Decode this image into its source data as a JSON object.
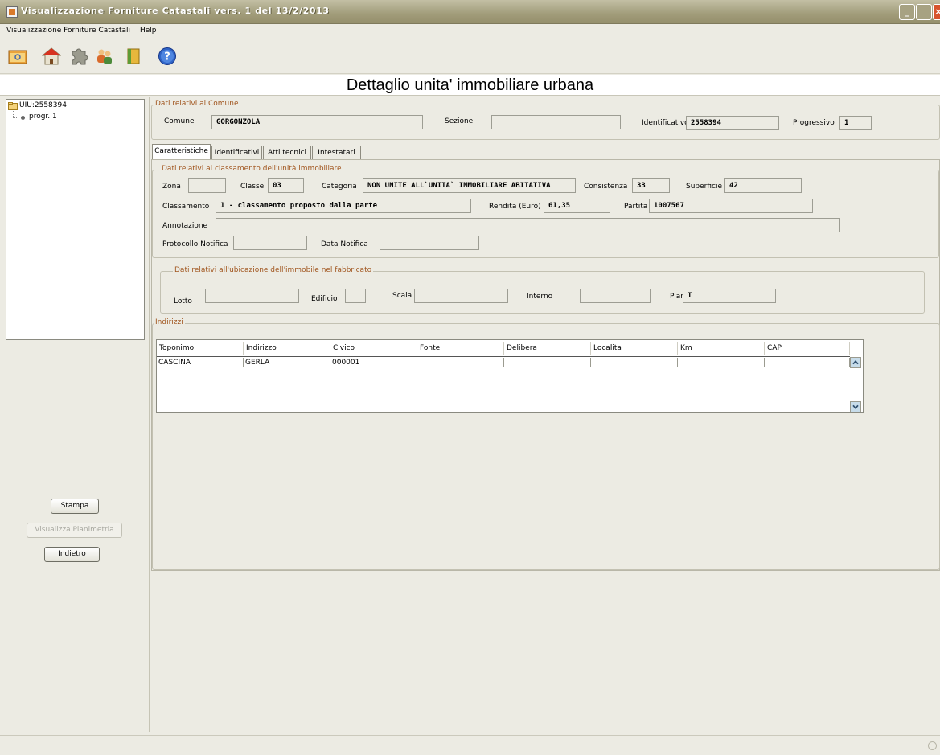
{
  "window": {
    "title": "Visualizzazione Forniture Catastali vers. 1 del 13/2/2013",
    "minimize_label": "_",
    "maximize_label": "▫",
    "close_label": "×"
  },
  "menu": {
    "items": [
      "Visualizzazione Forniture Catastali",
      "Help"
    ]
  },
  "toolbar": {
    "icons": [
      "open-folder-icon",
      "house-icon",
      "puzzle-icon",
      "users-icon",
      "book-icon",
      "help-icon"
    ]
  },
  "page_title": "Dettaglio unita' immobiliare urbana",
  "tree": {
    "root": "UIU:2558394",
    "child": "progr. 1"
  },
  "buttons": {
    "stampa": "Stampa",
    "visualizza": "Visualizza Planimetria",
    "indietro": "Indietro"
  },
  "comune_group": {
    "legend": "Dati relativi al Comune",
    "comune_label": "Comune",
    "comune_value": "GORGONZOLA",
    "sezione_label": "Sezione",
    "sezione_value": "",
    "identificativo_label": "Identificativo",
    "identificativo_value": "2558394",
    "progressivo_label": "Progressivo",
    "progressivo_value": "1"
  },
  "tabs": [
    "Caratteristiche",
    "Identificativi",
    "Atti tecnici",
    "Intestatari"
  ],
  "classamento": {
    "legend": "Dati relativi al classamento dell'unità immobiliare",
    "zona_label": "Zona",
    "zona_value": "",
    "classe_label": "Classe",
    "classe_value": "03",
    "categoria_label": "Categoria",
    "categoria_value": "NON UNITE ALL`UNITA` IMMOBILIARE ABITATIVA",
    "consistenza_label": "Consistenza",
    "consistenza_value": "33",
    "superficie_label": "Superficie",
    "superficie_value": "42",
    "classamento_label": "Classamento",
    "classamento_value": "1 - classamento proposto dalla parte",
    "rendita_label": "Rendita (Euro)",
    "rendita_value": "61,35",
    "partita_label": "Partita",
    "partita_value": "1007567",
    "annotazione_label": "Annotazione",
    "annotazione_value": "",
    "protocollo_label": "Protocollo Notifica",
    "protocollo_value": "",
    "data_label": "Data Notifica",
    "data_value": ""
  },
  "ubicazione": {
    "legend": "Dati relativi all'ubicazione dell'immobile nel fabbricato",
    "lotto_label": "Lotto",
    "lotto_value": "",
    "edificio_label": "Edificio",
    "edificio_value": "",
    "scala_label": "Scala",
    "scala_value": "",
    "interno_label": "Interno",
    "interno_value": "",
    "piano_label": "Piano",
    "piano_value": "T"
  },
  "indirizzi": {
    "legend": "Indirizzi",
    "columns": [
      "Toponimo",
      "Indirizzo",
      "Civico",
      "Fonte",
      "Delibera",
      "Localita",
      "Km",
      "CAP"
    ],
    "rows": [
      [
        "CASCINA",
        "GERLA",
        "000001",
        "",
        "",
        "",
        "",
        ""
      ]
    ]
  },
  "colors": {
    "background": "#ecebe3",
    "titlebar": "#a19c7a",
    "legend_text": "#a1561f"
  }
}
